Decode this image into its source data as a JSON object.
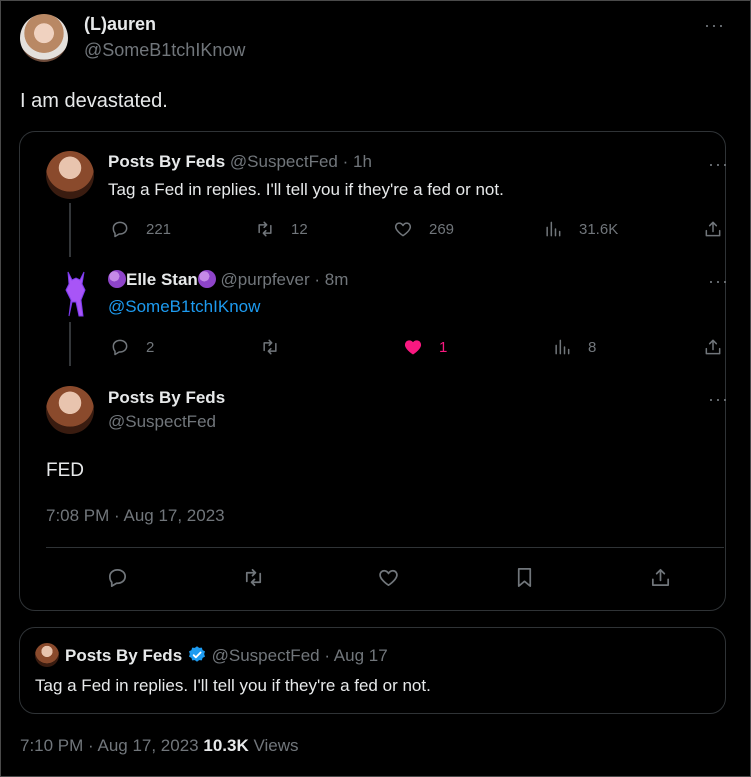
{
  "tweet": {
    "display_name": "(L)auren",
    "handle": "@SomeB1tchIKnow",
    "text": "I am devastated.",
    "timestamp": "7:10 PM · Aug 17, 2023",
    "views_count": "10.3K",
    "views_label": "Views",
    "more": "···"
  },
  "quoted_thread": {
    "first": {
      "name": "Posts By Feds",
      "handle": "@SuspectFed",
      "time": "· 1h",
      "text": "Tag a Fed in replies. I'll tell you if they're a fed or not.",
      "replies": "221",
      "retweets": "12",
      "likes": "269",
      "views": "31.6K",
      "more": "···"
    },
    "second": {
      "name": "Elle Stan",
      "handle": "@purpfever",
      "time": "· 8m",
      "text": "@SomeB1tchIKnow",
      "replies": "2",
      "likes": "1",
      "views": "8",
      "more": "···"
    },
    "main": {
      "name": "Posts By Feds",
      "handle": "@SuspectFed",
      "text": "FED",
      "timestamp": "7:08 PM · Aug 17, 2023",
      "more": "···"
    }
  },
  "quote_card": {
    "name": "Posts By Feds",
    "handle": "@SuspectFed",
    "time": "· Aug 17",
    "text": "Tag a Fed in replies. I'll tell you if they're a fed or not."
  },
  "colors": {
    "like_active": "#f91880",
    "link": "#1d9bf0",
    "verified": "#1d9bf0"
  }
}
